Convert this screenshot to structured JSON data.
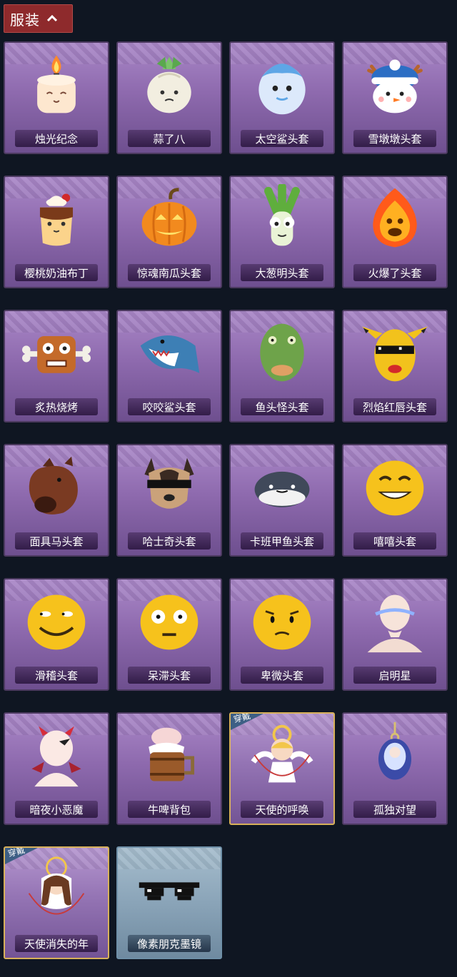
{
  "header": {
    "label": "服装"
  },
  "items": [
    {
      "name": "烛光纪念",
      "icon": "candle-icon"
    },
    {
      "name": "蒜了八",
      "icon": "garlic-icon"
    },
    {
      "name": "太空鲨头套",
      "icon": "space-shark-icon"
    },
    {
      "name": "雪墩墩头套",
      "icon": "snowman-icon"
    },
    {
      "name": "樱桃奶油布丁",
      "icon": "pudding-icon"
    },
    {
      "name": "惊魂南瓜头套",
      "icon": "pumpkin-icon"
    },
    {
      "name": "大葱明头套",
      "icon": "scallion-icon"
    },
    {
      "name": "火爆了头套",
      "icon": "fire-icon"
    },
    {
      "name": "炙热烧烤",
      "icon": "bbq-icon"
    },
    {
      "name": "咬咬鲨头套",
      "icon": "shark-icon"
    },
    {
      "name": "鱼头怪头套",
      "icon": "fish-head-icon"
    },
    {
      "name": "烈焰红唇头套",
      "icon": "pikachu-mask-icon"
    },
    {
      "name": "面具马头套",
      "icon": "horse-mask-icon"
    },
    {
      "name": "哈士奇头套",
      "icon": "husky-icon"
    },
    {
      "name": "卡班甲鱼头套",
      "icon": "fish-icon"
    },
    {
      "name": "嘻嘻头套",
      "icon": "grin-emoji-icon"
    },
    {
      "name": "滑稽头套",
      "icon": "funny-emoji-icon"
    },
    {
      "name": "呆滞头套",
      "icon": "dazed-emoji-icon"
    },
    {
      "name": "卑微头套",
      "icon": "humble-emoji-icon"
    },
    {
      "name": "启明星",
      "icon": "halo-head-icon"
    },
    {
      "name": "暗夜小恶魔",
      "icon": "devil-icon"
    },
    {
      "name": "牛啤背包",
      "icon": "beer-barrel-icon"
    },
    {
      "name": "天使的呼唤",
      "icon": "angel-icon",
      "badge": "穿戴"
    },
    {
      "name": "孤独对望",
      "icon": "pendant-icon"
    },
    {
      "name": "天使消失的年",
      "icon": "angel-girl-icon",
      "badge": "穿戴"
    },
    {
      "name": "像素朋克墨镜",
      "icon": "pixel-sunglasses-icon"
    }
  ]
}
